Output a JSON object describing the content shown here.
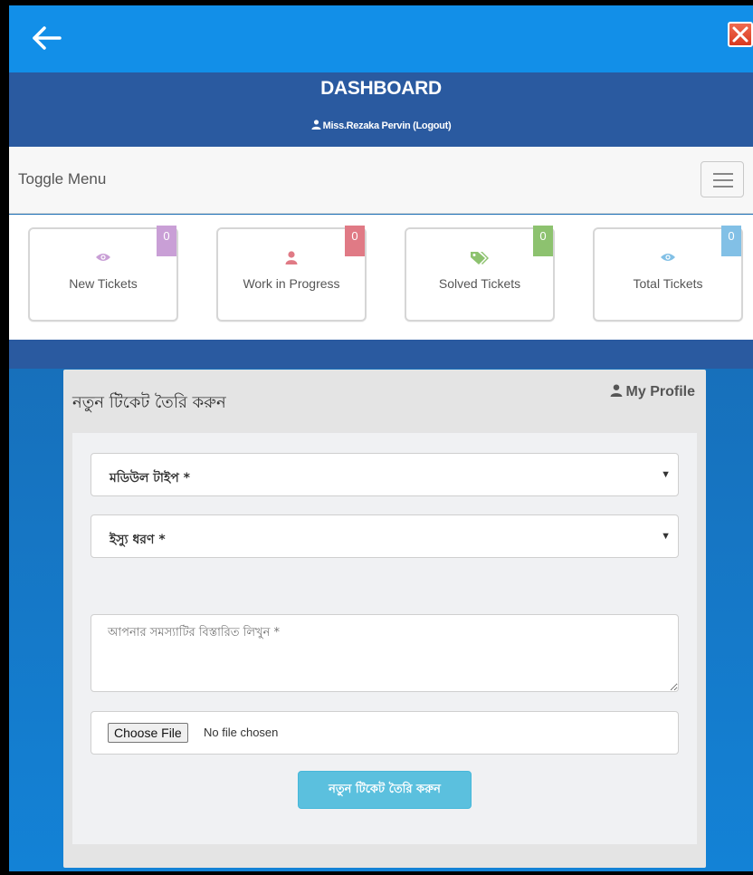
{
  "appbar": {
    "back_icon": "arrow-left-icon",
    "close_icon": "close-icon",
    "colors": {
      "background": "#128fe8",
      "close": "#d9391f"
    }
  },
  "header": {
    "title": "DASHBOARD",
    "user_name": "Miss.Rezaka Pervin",
    "logout_label": "(Logout)",
    "user_icon": "user-icon",
    "background": "#2a5aa0"
  },
  "toggle_menu": {
    "label": "Toggle Menu",
    "icon": "hamburger-icon"
  },
  "stats": [
    {
      "label": "New Tickets",
      "count": "0",
      "icon": "eye-icon",
      "icon_color": "#c99fd6",
      "badge_color": "#c99fd6"
    },
    {
      "label": "Work in Progress",
      "count": "0",
      "icon": "user-icon",
      "icon_color": "#e07a85",
      "badge_color": "#e07a85"
    },
    {
      "label": "Solved Tickets",
      "count": "0",
      "icon": "tags-icon",
      "icon_color": "#8dc26f",
      "badge_color": "#8dc26f"
    },
    {
      "label": "Total Tickets",
      "count": "0",
      "icon": "eye-icon",
      "icon_color": "#82c0e6",
      "badge_color": "#82c0e6"
    }
  ],
  "form": {
    "title": "নতুন টিকেট তৈরি করুন",
    "my_profile_label": "My Profile",
    "module_type": {
      "value": "মডিউল টাইপ *"
    },
    "issue_type": {
      "value": "ইস্যু ধরণ *"
    },
    "details": {
      "placeholder": "আপনার সমস্যাটির বিস্তারিত লিখুন *"
    },
    "file": {
      "button_label": "Choose File",
      "status": "No file chosen"
    },
    "submit_label": "নতুন টিকেট তৈরি করুন"
  }
}
